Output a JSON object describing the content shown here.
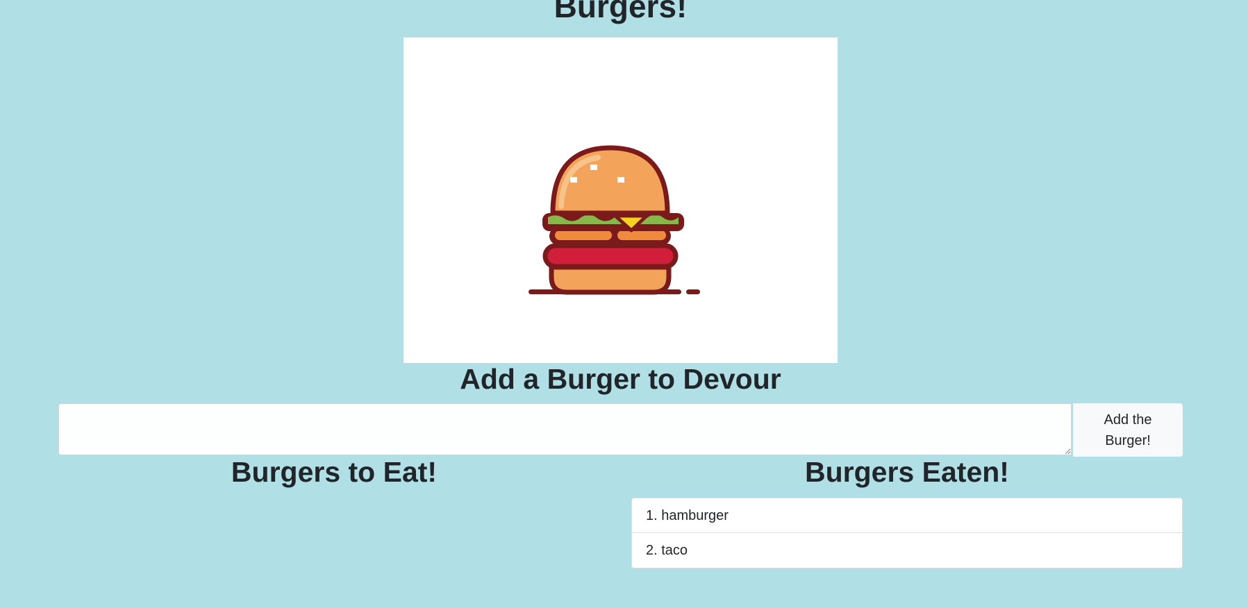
{
  "page": {
    "title": "Burgers!",
    "background_color": "#b0dfe5"
  },
  "hero_image": {
    "icon": "hamburger-icon"
  },
  "add_section": {
    "heading": "Add a Burger to Devour",
    "input_value": "",
    "button_label": "Add the Burger!"
  },
  "to_eat": {
    "heading": "Burgers to Eat!",
    "items": []
  },
  "eaten": {
    "heading": "Burgers Eaten!",
    "items": [
      {
        "label": "1. hamburger"
      },
      {
        "label": "2. taco"
      }
    ]
  }
}
